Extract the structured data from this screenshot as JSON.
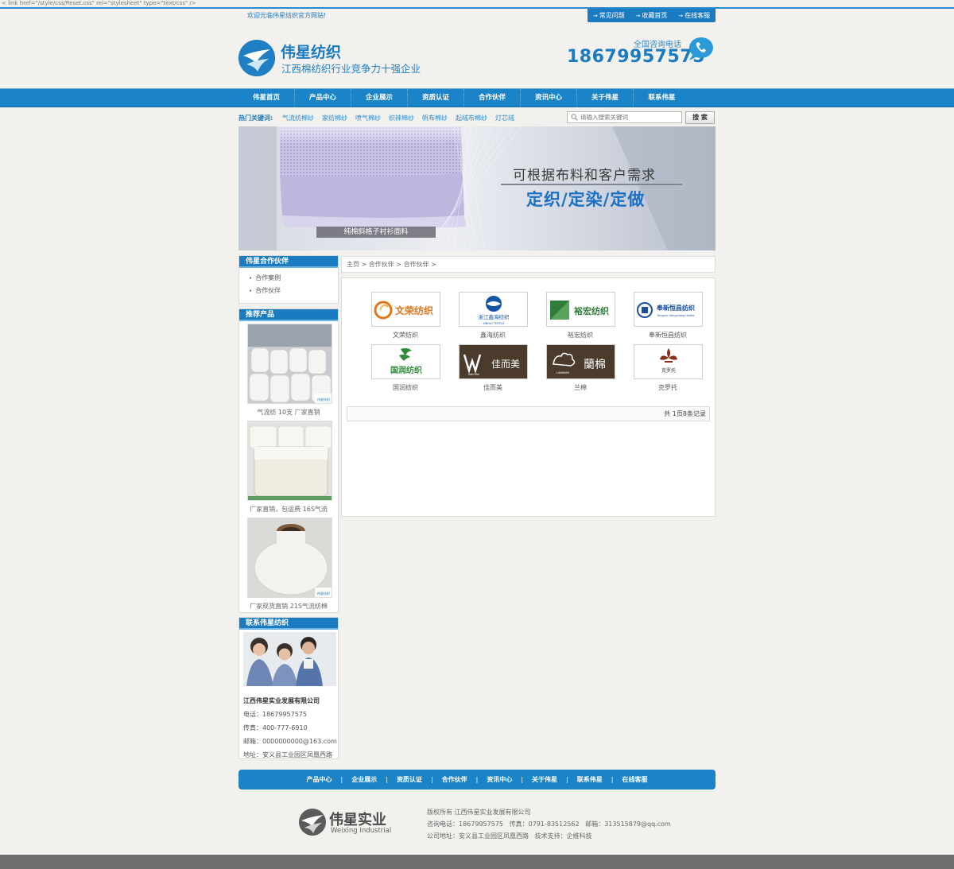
{
  "raw_text": "< link href=\"/style/css/Reset.css\" rel=\"stylesheet\" type=\"text/css\" />",
  "header": {
    "welcome": "欢迎光临伟星纺织官方网站!",
    "top_links": [
      "常见问题",
      "收藏首页",
      "在线客服"
    ],
    "brand_name": "伟星纺织",
    "slogan": "江西棉纺织行业竞争力十强企业",
    "hotline_label": "全国咨询电话",
    "hotline": "18679957575"
  },
  "nav": [
    "伟星首页",
    "产品中心",
    "企业展示",
    "资质认证",
    "合作伙伴",
    "资讯中心",
    "关于伟星",
    "联系伟星"
  ],
  "keywords": {
    "label": "热门关键词:",
    "items": [
      "气流纺棉纱",
      "家纺棉纱",
      "喷气棉纱",
      "织袜棉纱",
      "帆布棉纱",
      "起绒布棉纱",
      "灯芯绒"
    ]
  },
  "search": {
    "placeholder": "请输入搜索关键词",
    "button": "搜 索"
  },
  "banner": {
    "caption": "纯棉斜格子衬衫面料",
    "line1": "可根据布料和客户需求",
    "line2": "定织/定染/定做"
  },
  "sidebar": {
    "partners_title": "伟星合作伙伴",
    "partner_links": [
      "合作案例",
      "合作伙伴"
    ],
    "products_title": "推荐产品",
    "products": [
      {
        "caption": "气流纺 10支 厂家直销",
        "watermark": "伟星纺织"
      },
      {
        "caption": "厂家直销，包运费 16S气流"
      },
      {
        "caption": "厂家现货直销 21S气流纺棉",
        "watermark": "伟星纺织"
      }
    ],
    "contact_title": "联系伟星纺织",
    "contact": {
      "company": "江西伟星实业发展有限公司",
      "phone": "电话：18679957575",
      "fax": "传真：400-777-6910",
      "email": "邮箱：0000000000@163.com",
      "address": "地址：安义县工业园区凤凰西路"
    }
  },
  "breadcrumb": "主页 > 合作伙伴 > 合作伙伴 >",
  "partners": [
    {
      "name": "文荣纺织",
      "logo_text": "文荣纺织",
      "logo_color": "#e2761a"
    },
    {
      "name": "鑫海纺织",
      "logo_text": "浙江鑫海纺织",
      "logo_sub": "XINHAI TEXTILE",
      "logo_color": "#1456a3"
    },
    {
      "name": "裕宏纺织",
      "logo_text": "裕宏纺织",
      "logo_color": "#2e7d3a"
    },
    {
      "name": "奉新恒昌纺织",
      "logo_text": "奉新恒昌纺织",
      "logo_sub": "Fengxin Hengchang textile",
      "logo_color": "#1c4f9c"
    },
    {
      "name": "国润纺织",
      "logo_text": "国润纺织",
      "logo_color": "#2f8a3a"
    },
    {
      "name": "佳而美",
      "logo_text": "佳而美",
      "logo_sub": "JiaErMei",
      "logo_color": "#4a3b2c"
    },
    {
      "name": "兰棉",
      "logo_text": "蘭棉",
      "logo_sub": "LANMIAN",
      "logo_color": "#4a3b2c"
    },
    {
      "name": "克罗托",
      "logo_text": "克罗托",
      "logo_color": "#8a2e1a"
    }
  ],
  "pager": "共 1页8条记录",
  "footer": {
    "nav": [
      "产品中心",
      "企业展示",
      "资质认证",
      "合作伙伴",
      "资讯中心",
      "关于伟星",
      "联系伟星",
      "在线客服"
    ],
    "brand": "伟星实业",
    "brand_en": "Weixing Industrial",
    "copyright": "版权所有 江西伟星实业发展有限公司",
    "contact_line": "咨询电话：18679957575   传真：0791-83512562   邮箱：313515879@qq.com",
    "address_line": "公司地址：安义县工业园区凤凰西路   技术支持：企维科技"
  },
  "colors": {
    "primary": "#1b7bc0",
    "nav_bar": "#1b84c8",
    "page_bg": "#f2f1ee"
  }
}
